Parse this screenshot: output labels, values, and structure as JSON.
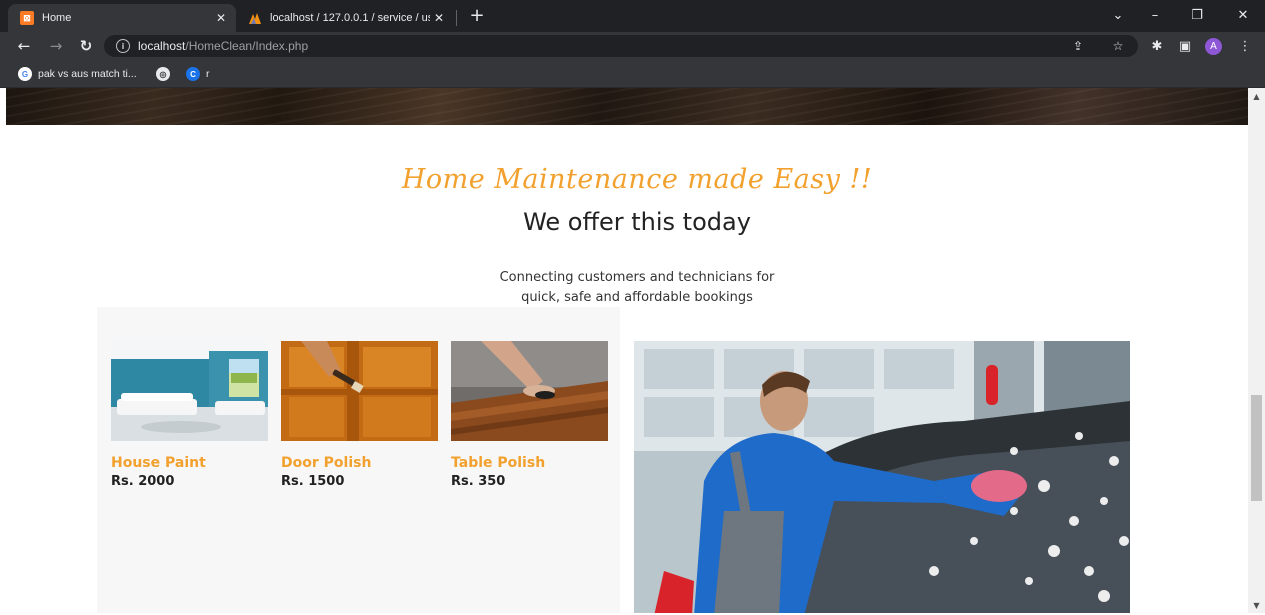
{
  "browser": {
    "tabs": [
      {
        "title": "Home",
        "favicon": "xampp-icon",
        "active": true
      },
      {
        "title": "localhost / 127.0.0.1 / service / us",
        "favicon": "phpmyadmin-icon",
        "active": false
      }
    ],
    "address": {
      "host": "localhost",
      "path": "/HomeClean/Index.php"
    },
    "bookmarks": [
      {
        "label": "pak vs aus match ti...",
        "icon": "google-icon"
      },
      {
        "label": "",
        "icon": "globe-icon"
      },
      {
        "label": "r",
        "icon": "chromium-icon"
      }
    ],
    "profile_initial": "A"
  },
  "page": {
    "tagline": "Home Maintenance made Easy !!",
    "heading": "We offer this today",
    "subtitle_line1": "Connecting customers and technicians for",
    "subtitle_line2": "quick, safe and affordable bookings",
    "services": [
      {
        "name": "House Paint",
        "price": "Rs. 2000"
      },
      {
        "name": "Door Polish",
        "price": "Rs. 1500"
      },
      {
        "name": "Table Polish",
        "price": "Rs. 350"
      }
    ]
  },
  "colors": {
    "accent": "#f2a12e",
    "chrome_dark": "#202124",
    "chrome_toolbar": "#35363a"
  }
}
